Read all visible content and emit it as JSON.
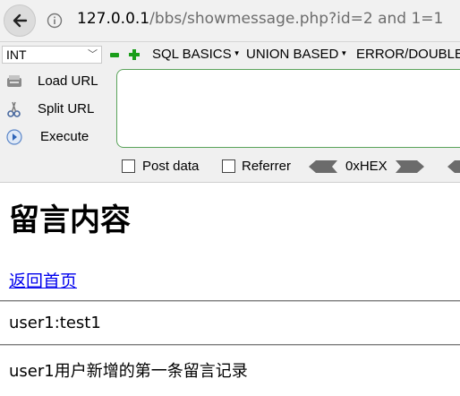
{
  "browser": {
    "url_host": "127.0.0.1",
    "url_path": "/bbs/showmessage.php?id=2 and 1=1"
  },
  "hackbar": {
    "select_value": "INT",
    "menus": [
      "SQL BASICS",
      "UNION BASED",
      "ERROR/DOUBLE"
    ],
    "load_url": "Load URL",
    "split_url": "Split URL",
    "execute": "Execute",
    "post_data": "Post data",
    "referrer": "Referrer",
    "hex_label": "0xHEX"
  },
  "page": {
    "title": "留言内容",
    "back_link": "返回首页",
    "message_title": "user1:test1",
    "message_body": "user1用户新增的第一条留言记录"
  }
}
